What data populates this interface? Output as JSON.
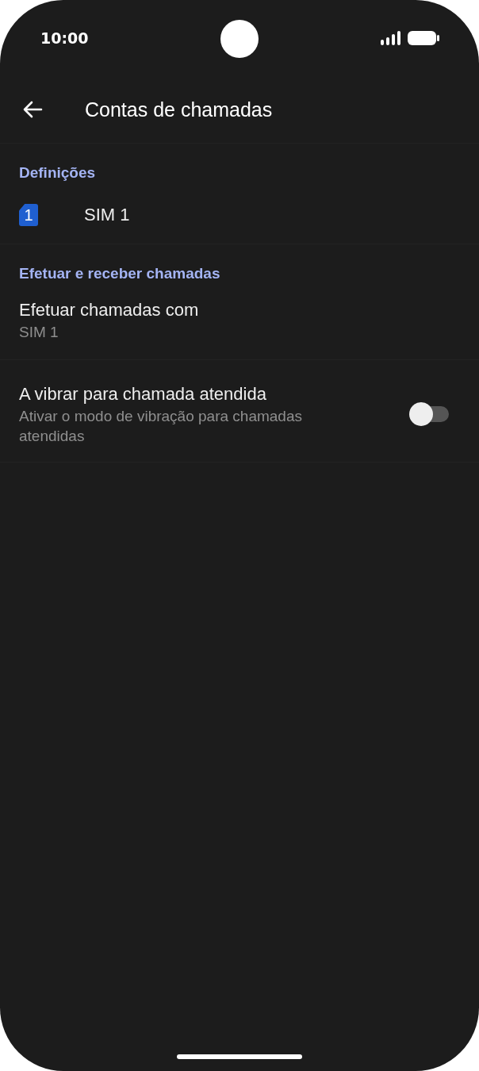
{
  "status_bar": {
    "time": "10:00"
  },
  "app_bar": {
    "title": "Contas de chamadas"
  },
  "sections": [
    {
      "header": "Definições",
      "items": [
        {
          "kind": "sim",
          "badge": "1",
          "title": "SIM 1"
        }
      ]
    },
    {
      "header": "Efetuar e receber chamadas",
      "items": [
        {
          "kind": "text",
          "title": "Efetuar chamadas com",
          "subtitle": "SIM 1"
        },
        {
          "kind": "switch",
          "title": "A vibrar para chamada atendida",
          "subtitle": "Ativar o modo de vibração para chamadas atendidas",
          "on": false
        }
      ]
    }
  ]
}
